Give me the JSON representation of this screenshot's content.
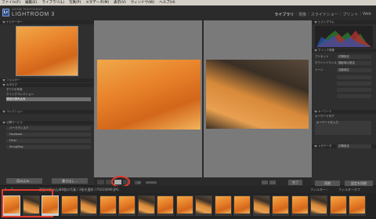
{
  "menu": {
    "items": [
      "ファイル(F)",
      "編集(E)",
      "ライブラリ(L)",
      "写真(P)",
      "メタデータ(M)",
      "表示(V)",
      "ウィンドウ(W)",
      "ヘルプ(H)"
    ]
  },
  "app": {
    "logo": "Lr",
    "sub": "ADOBE PHOTOSHOP",
    "name": "LIGHTROOM 3"
  },
  "modules": {
    "library": "ライブラリ",
    "develop": "現像",
    "slideshow": "スライドショー",
    "print": "プリント",
    "web": "Web"
  },
  "left_panel": {
    "navigator": "ナビゲーター",
    "catalog": "カタログ",
    "catalog_items": [
      "すべての写真",
      "クイックコレクション",
      "前回の読み込み"
    ],
    "folders": "フォルダー",
    "collections": "コレクション",
    "publish": "公開サービス",
    "publish_items": [
      "ハードディスク",
      "Facebook",
      "Flickr",
      "SmugMug"
    ],
    "import_btn": "読み込み...",
    "export_btn": "書き出し..."
  },
  "right_panel": {
    "histogram": "ヒストグラム",
    "quick_develop": "クイック現像",
    "preset_label": "プリセット",
    "preset_value": "初期設定",
    "wb_label": "ホワイトバランス",
    "wb_value": "撮影時の設定",
    "tone_label": "トーン",
    "auto_tone": "自動補正",
    "keywords": "キーワード",
    "keyword_tags": "キーワードタグ",
    "keyword_entry": "キーワードを入力",
    "metadata": "メタデータ",
    "metadata_preset": "初期設定",
    "sync_btn": "同期",
    "sync_settings_btn": "設定を同期"
  },
  "toolbar": {
    "compare": "比較",
    "select": "選択",
    "candidate": "候補",
    "done": "完了"
  },
  "filmstrip": {
    "page1": "1",
    "page2": "2",
    "source": "前回の読み込み",
    "count": "19枚の写真 / 2枚を選択 / P1010099.JPG",
    "filter": "フィルター :",
    "filter_off": "フィルターオフ"
  },
  "colors": {
    "accent": "#e33b2e",
    "panel": "#2f2f2f",
    "center": "#7a7a7a"
  }
}
